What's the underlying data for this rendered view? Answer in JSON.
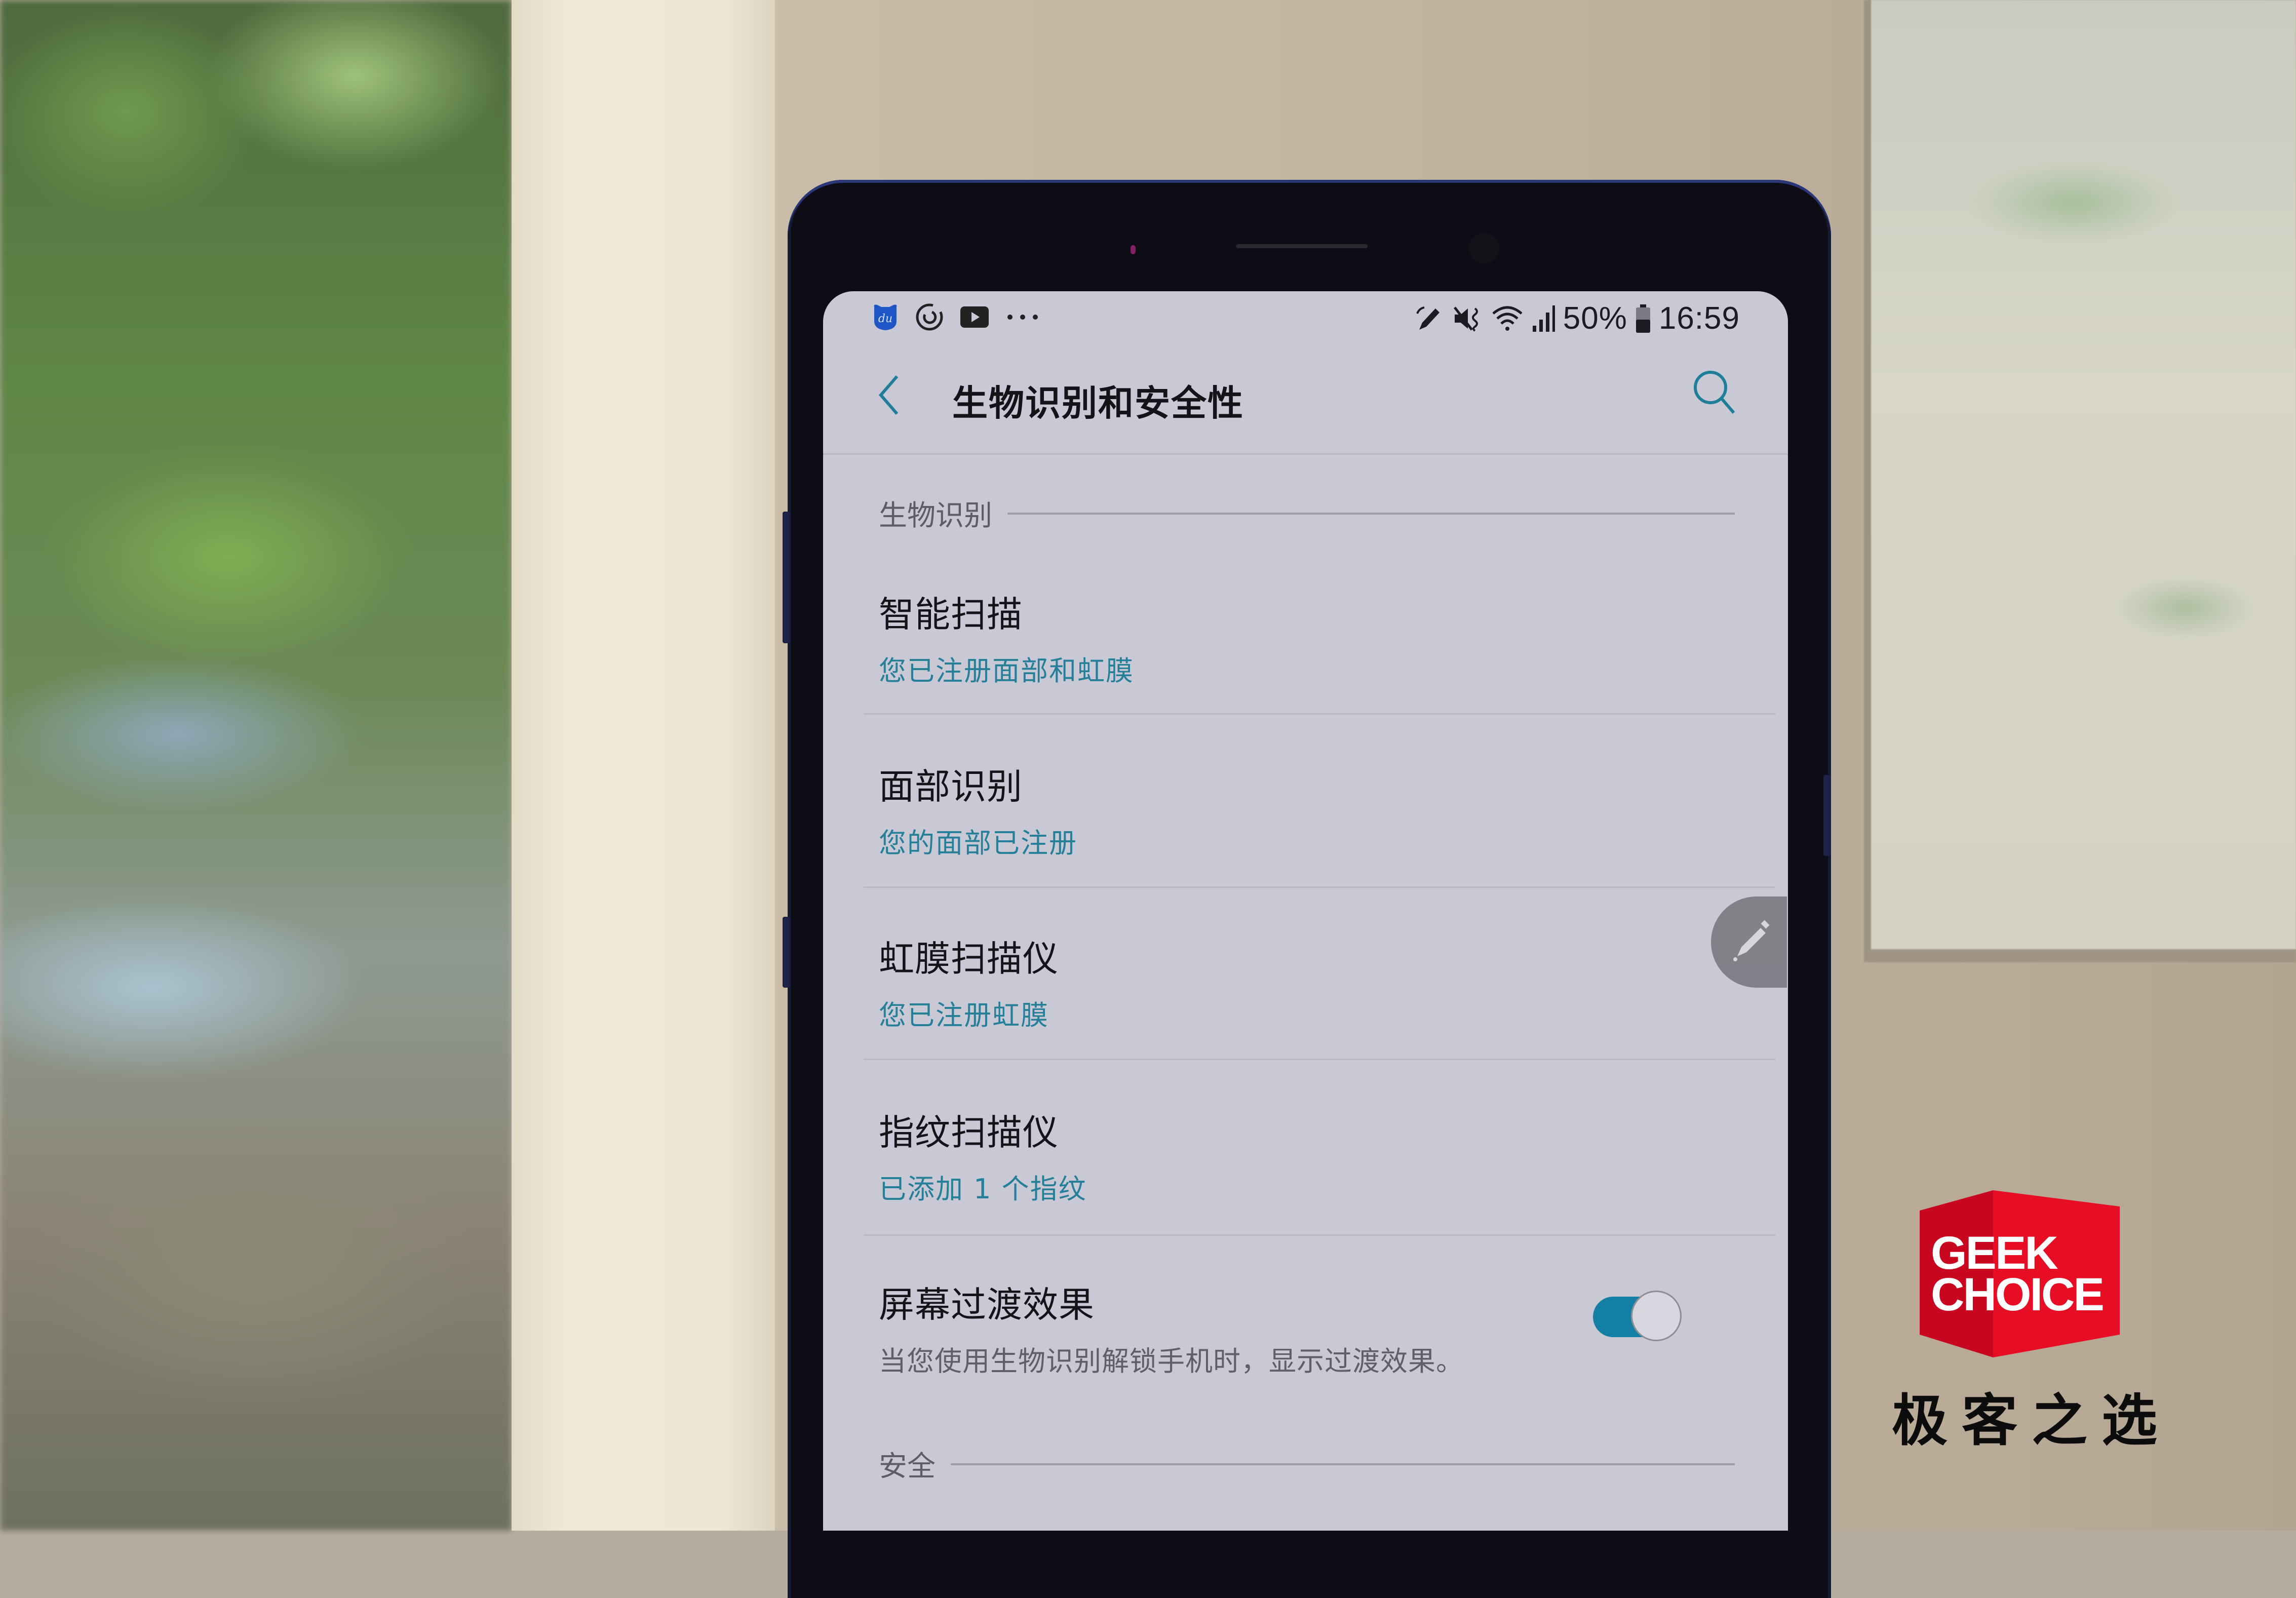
{
  "status_bar": {
    "left_icons": [
      "du-app-icon",
      "sync-icon",
      "video-icon",
      "more-notifications-icon"
    ],
    "right_icons": [
      "pen-icon",
      "mute-vibrate-icon",
      "wifi-icon",
      "signal-icon",
      "battery-icon"
    ],
    "battery": "50%",
    "time": "16:59"
  },
  "app_bar": {
    "title": "生物识别和安全性",
    "back_icon": "chevron-left-icon",
    "search_icon": "search-icon"
  },
  "sections": [
    {
      "header": "生物识别",
      "items": [
        {
          "title": "智能扫描",
          "subtitle": "您已注册面部和虹膜"
        },
        {
          "title": "面部识别",
          "subtitle": "您的面部已注册"
        },
        {
          "title": "虹膜扫描仪",
          "subtitle": "您已注册虹膜"
        },
        {
          "title": "指纹扫描仪",
          "subtitle": "已添加 1 个指纹"
        },
        {
          "title": "屏幕过渡效果",
          "subtitle": "当您使用生物识别解锁手机时，显示过渡效果。",
          "toggle": true,
          "toggle_on": true
        }
      ]
    },
    {
      "header": "安全",
      "items": []
    }
  ],
  "edge_panel": {
    "icon": "pencil-icon"
  },
  "colors": {
    "accent": "#137fa3",
    "subtitle": "#257f99",
    "screen_bg": "#c9c9d6",
    "logo_red": "#e60d24"
  },
  "watermark": {
    "line1": "GEEK",
    "line2": "CHOICE",
    "cn": "极客之选"
  }
}
